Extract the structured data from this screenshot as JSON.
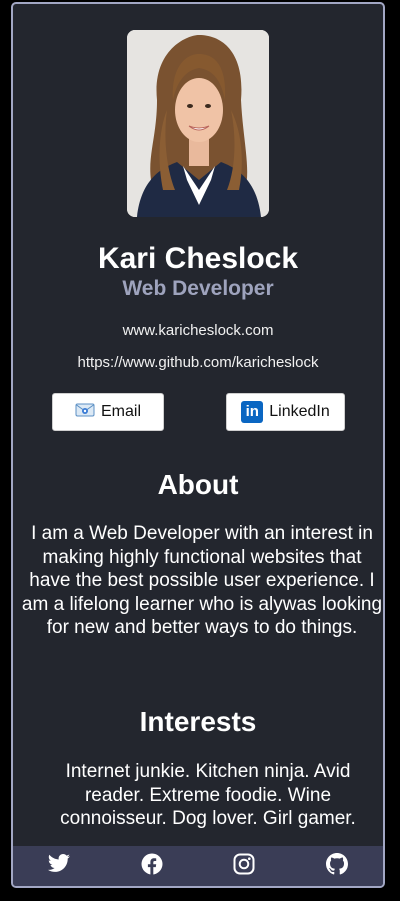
{
  "profile": {
    "name": "Kari Cheslock",
    "title": "Web Developer",
    "website": "www.karicheslock.com",
    "github": "https://www.github.com/karicheslock"
  },
  "buttons": {
    "email_label": "Email",
    "linkedin_label": "LinkedIn",
    "email_icon": "email-icon",
    "linkedin_icon": "linkedin-icon",
    "linkedin_glyph": "in"
  },
  "about": {
    "heading": "About",
    "text": "I am a Web Developer with an interest in making highly functional websites that have the best possible user experience. I am a lifelong learner who is alywas looking for new and better ways to do things."
  },
  "interests": {
    "heading": "Interests",
    "text": "Internet junkie. Kitchen ninja. Avid reader. Extreme foodie. Wine connoisseur. Dog lover. Girl gamer."
  },
  "footer": {
    "icons": [
      "twitter-icon",
      "facebook-icon",
      "instagram-icon",
      "github-icon"
    ]
  },
  "colors": {
    "card_background": "#23262e",
    "card_border": "#a2a7c4",
    "subtitle": "#9ea3bd",
    "footer_background": "#3a3d56",
    "linkedin_blue": "#0a66c2"
  }
}
